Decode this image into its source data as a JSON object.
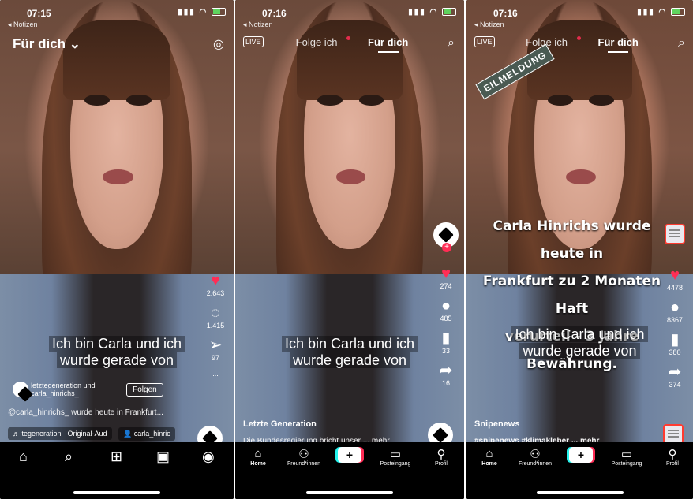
{
  "panel1": {
    "status": {
      "time": "07:15",
      "back": "◂ Notizen"
    },
    "header": {
      "title": "Für dich ⌄"
    },
    "caption": [
      "Ich bin Carla und ich",
      "wurde gerade von"
    ],
    "rail": {
      "likes": "2.643",
      "comments": "1.415",
      "shares": "97",
      "more": "..."
    },
    "account": {
      "name": "letztegeneration und carla_hinrichs_",
      "follow": "Folgen"
    },
    "description": "@carla_hinrichs_ wurde heute in Frankfurt...",
    "music": {
      "sound": "♬ tegeneration · Original-Aud",
      "user": "👤 carla_hinric"
    }
  },
  "panel2": {
    "status": {
      "time": "07:16",
      "back": "◂ Notizen"
    },
    "tabs": {
      "following": "Folge ich",
      "foryou": "Für dich"
    },
    "live": "LIVE",
    "caption": [
      "Ich bin Carla und ich",
      "wurde gerade von"
    ],
    "rail": {
      "likes": "274",
      "comments": "485",
      "saves": "33",
      "shares": "16"
    },
    "account": "Letzte Generation",
    "description": "Die Bundesregierung bricht unser ... mehr",
    "nav": {
      "home": "Home",
      "friends": "Freund*innen",
      "inbox": "Posteingang",
      "profile": "Profil"
    }
  },
  "panel3": {
    "status": {
      "time": "07:16",
      "back": "◂ Notizen"
    },
    "tabs": {
      "following": "Folge ich",
      "foryou": "Für dich"
    },
    "live": "LIVE",
    "badge": "EILMELDUNG",
    "headline": [
      "Carla Hinrichs wurde heute in",
      "Frankfurt zu 2 Monaten Haft",
      "verurteil - 3 Jahre",
      "Bewährung."
    ],
    "caption": [
      "Ich bin Carla und ich",
      "wurde gerade von"
    ],
    "rail": {
      "likes": "4478",
      "comments": "8367",
      "saves": "380",
      "shares": "374"
    },
    "account": "Snipenews",
    "description": "#snipenews #klimakleber ... mehr",
    "nav": {
      "home": "Home",
      "friends": "Freund*innen",
      "inbox": "Posteingang",
      "profile": "Profil"
    }
  }
}
